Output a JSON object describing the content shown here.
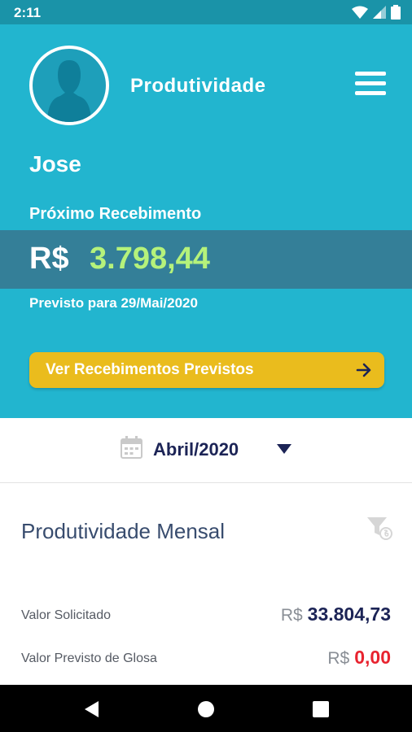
{
  "status_bar": {
    "time": "2:11"
  },
  "header": {
    "title": "Produtividade",
    "user_name": "Jose",
    "next_payment_label": "Próximo Recebimento",
    "currency": "R$",
    "amount": "3.798,44",
    "expected_date": "Previsto para 29/Mai/2020",
    "cta_label": "Ver Recebimentos Previstos"
  },
  "month_selector": {
    "value": "Abril/2020"
  },
  "section": {
    "title": "Produtividade Mensal",
    "rows": [
      {
        "label": "Valor Solicitado",
        "currency": "R$",
        "value": "33.804,73",
        "color": "#1c2456"
      },
      {
        "label": "Valor Previsto de Glosa",
        "currency": "R$",
        "value": "0,00",
        "color": "#e8232f"
      }
    ]
  },
  "colors": {
    "header_bg": "#22b5cf",
    "status_bar_bg": "#1a93a8",
    "amount_band_bg": "#347f98",
    "amount_text": "#b5f27b",
    "cta_bg": "#eabc1d",
    "navy": "#1c2456",
    "alert_red": "#e8232f"
  },
  "icons": [
    "wifi-icon",
    "signal-icon",
    "battery-icon",
    "avatar-icon",
    "menu-icon",
    "arrow-right-icon",
    "calendar-icon",
    "caret-down-icon",
    "filter-icon",
    "nav-back-icon",
    "nav-home-icon",
    "nav-recents-icon"
  ]
}
